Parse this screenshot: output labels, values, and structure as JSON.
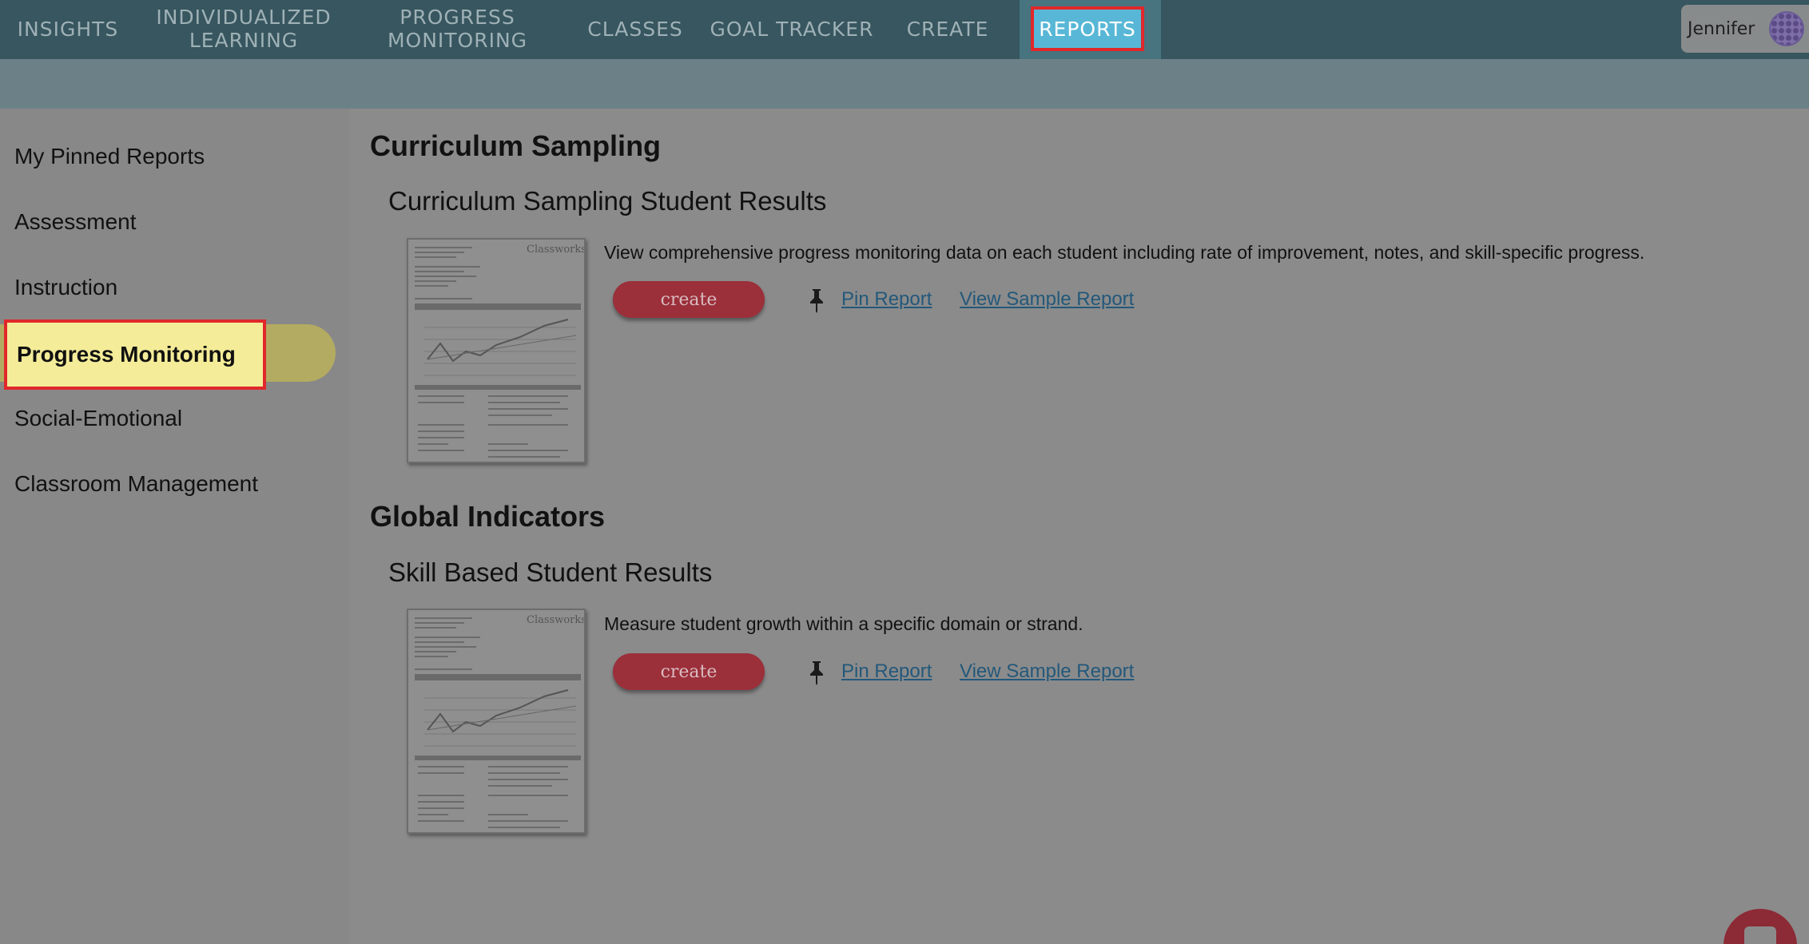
{
  "nav": {
    "items": [
      {
        "label": "INSIGHTS"
      },
      {
        "label": "INDIVIDUALIZED\nLEARNING"
      },
      {
        "label": "PROGRESS\nMONITORING"
      },
      {
        "label": "CLASSES"
      },
      {
        "label": "GOAL TRACKER"
      },
      {
        "label": "CREATE"
      },
      {
        "label": "REPORTS",
        "active": true
      }
    ],
    "user_name": "Jennifer",
    "active_color": "#58b7d6",
    "highlight_color": "#e0282b"
  },
  "sidebar": {
    "items": [
      {
        "label": "My Pinned Reports"
      },
      {
        "label": "Assessment"
      },
      {
        "label": "Instruction"
      },
      {
        "label": "Progress Monitoring",
        "active": true
      },
      {
        "label": "Social-Emotional"
      },
      {
        "label": "Classroom Management"
      }
    ]
  },
  "sections": [
    {
      "title": "Curriculum Sampling",
      "reports": [
        {
          "title": "Curriculum Sampling Student Results",
          "description": "View comprehensive progress monitoring data on each student including rate of improvement, notes, and skill-specific progress.",
          "create_label": "create",
          "pin_label": "Pin Report",
          "sample_label": "View Sample Report",
          "thumb_brand": "Classworks"
        }
      ]
    },
    {
      "title": "Global Indicators",
      "reports": [
        {
          "title": "Skill Based Student Results",
          "description": "Measure student growth within a specific domain or strand.",
          "create_label": "create",
          "pin_label": "Pin Report",
          "sample_label": "View Sample Report",
          "thumb_brand": "Classworks"
        }
      ]
    }
  ],
  "colors": {
    "nav_bg": "#37565f",
    "create_button": "#9b2f3a",
    "link": "#23587a",
    "active_sidebar": "#f4ec98"
  }
}
